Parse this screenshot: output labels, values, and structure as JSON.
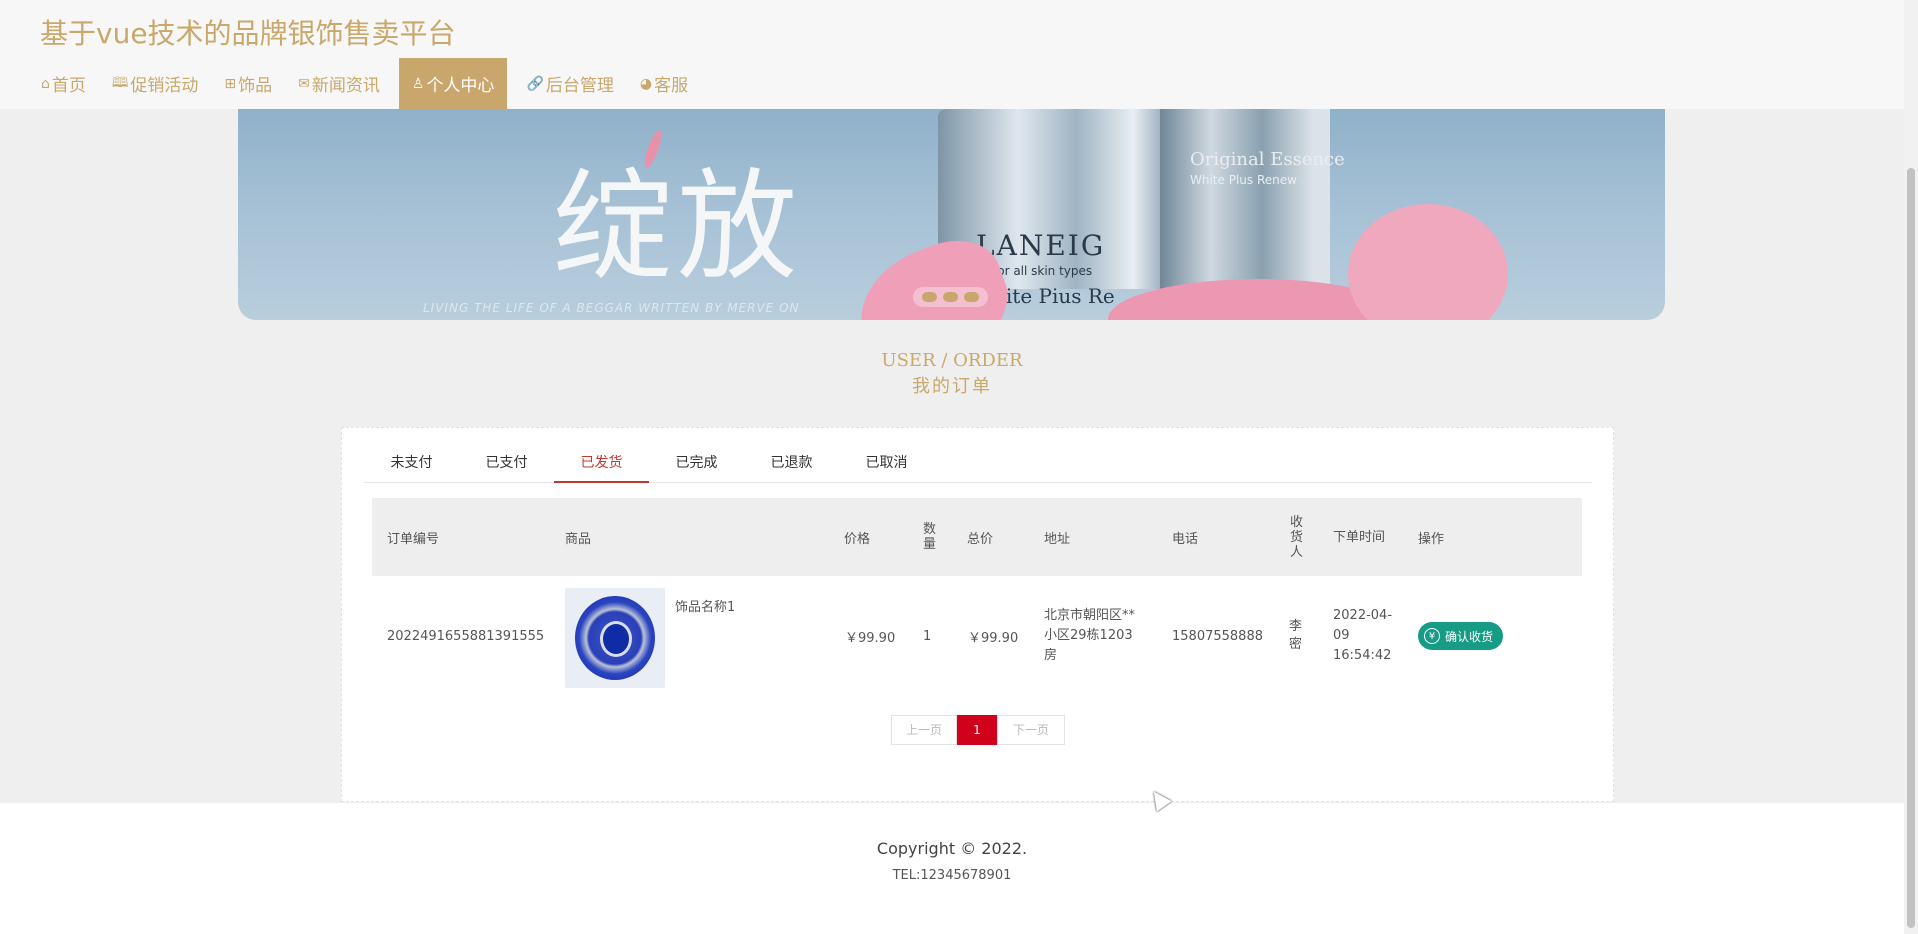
{
  "site": {
    "title": "基于vue技术的品牌银饰售卖平台"
  },
  "nav": [
    {
      "icon": "home-icon",
      "glyph": "⌂",
      "label": "首页"
    },
    {
      "icon": "book-icon",
      "glyph": "🕮",
      "label": "促销活动"
    },
    {
      "icon": "gift-icon",
      "glyph": "⊞",
      "label": "饰品"
    },
    {
      "icon": "mail-icon",
      "glyph": "✉",
      "label": "新闻资讯"
    },
    {
      "icon": "user-icon",
      "glyph": "♙",
      "label": "个人中心",
      "active": true
    },
    {
      "icon": "link-icon",
      "glyph": "🔗",
      "label": "后台管理"
    },
    {
      "icon": "headset-icon",
      "glyph": "◕",
      "label": "客服"
    }
  ],
  "banner": {
    "headline": "绽放",
    "tagline": "LIVING THE LIFE OF A BEGGAR WRITTEN BY MERVE ON",
    "jar_brand": "LANEIG",
    "jar_line1": "for all skin types",
    "jar_line2": "hite Pius Re",
    "bottle_line1": "Original Essence",
    "bottle_line2": "White Plus Renew"
  },
  "section": {
    "en": "USER / ORDER",
    "cn": "我的订单"
  },
  "tabs": [
    {
      "label": "未支付"
    },
    {
      "label": "已支付"
    },
    {
      "label": "已发货",
      "active": true
    },
    {
      "label": "已完成"
    },
    {
      "label": "已退款"
    },
    {
      "label": "已取消"
    }
  ],
  "table": {
    "headers": {
      "order_no": "订单编号",
      "product": "商品",
      "price": "价格",
      "qty": "数量",
      "total": "总价",
      "address": "地址",
      "phone": "电话",
      "receiver": "收货人",
      "time": "下单时间",
      "action": "操作"
    },
    "rows": [
      {
        "order_no": "2022491655881391555",
        "product_name": "饰品名称1",
        "price": "￥99.90",
        "qty": "1",
        "total": "￥99.90",
        "address": "北京市朝阳区**小区29栋1203房",
        "phone": "15807558888",
        "receiver": "李密",
        "time": "2022-04-09 16:54:42",
        "action_label": "确认收货"
      }
    ]
  },
  "pager": {
    "prev": "上一页",
    "current": "1",
    "next": "下一页"
  },
  "footer": {
    "copyright": "Copyright © 2022.",
    "tel": "TEL:12345678901"
  },
  "colors": {
    "accent": "#c9a66b",
    "active_tab": "#c0392b",
    "confirm": "#169b85",
    "page_current": "#d0021b"
  }
}
